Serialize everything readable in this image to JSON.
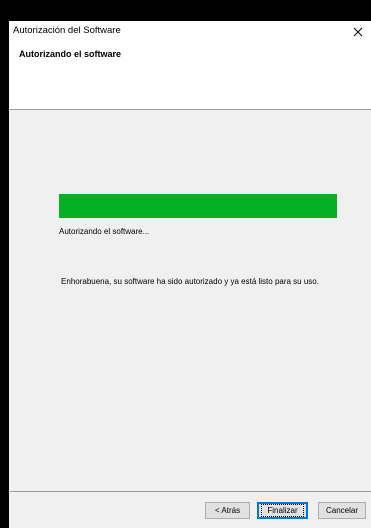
{
  "window": {
    "title": "Autorización del Software",
    "close_icon": "close-icon"
  },
  "header": {
    "title": "Autorizando el software"
  },
  "progress": {
    "value": 1.0,
    "color": "#06b025",
    "status_text": "Autorizando el software..."
  },
  "message": "Enhorabuena, su software ha sido autorizado y ya está listo para su uso.",
  "buttons": {
    "back_label": "< Atrás",
    "finish_label": "Finalizar",
    "cancel_label": "Cancelar"
  },
  "colors": {
    "accent": "#0078d7",
    "progress": "#06b025"
  }
}
